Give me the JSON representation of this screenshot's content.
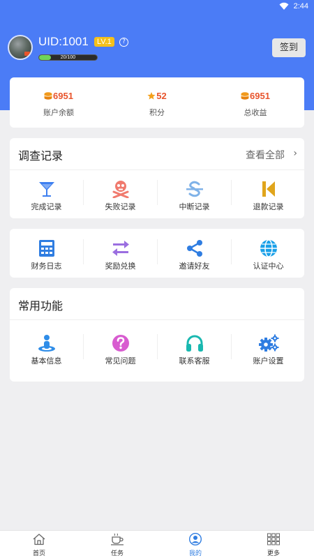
{
  "status_bar": {
    "time": "2:44"
  },
  "profile": {
    "uid": "UID:1001",
    "level": "LV.1",
    "help": "?",
    "xp_text": "20/100",
    "xp_progress": 0.2,
    "signin_label": "签到"
  },
  "stats": [
    {
      "value": "6951",
      "label": "账户余额",
      "icon": "coin-stack-icon"
    },
    {
      "value": "52",
      "label": "积分",
      "icon": "star-icon"
    },
    {
      "value": "6951",
      "label": "总收益",
      "icon": "coin-stack-icon"
    }
  ],
  "survey": {
    "title": "调查记录",
    "view_all": "查看全部",
    "items": [
      {
        "label": "完成记录",
        "icon": "cocktail-glass-icon",
        "color": "#3d7ff0"
      },
      {
        "label": "失败记录",
        "icon": "skull-crossbones-icon",
        "color": "#f07a6e"
      },
      {
        "label": "中断记录",
        "icon": "strikethrough-icon",
        "color": "#7fb2e8"
      },
      {
        "label": "退款记录",
        "icon": "skip-back-icon",
        "color": "#e0a51c"
      }
    ]
  },
  "finance": {
    "items": [
      {
        "label": "财务日志",
        "icon": "calculator-icon",
        "color": "#2f7de1"
      },
      {
        "label": "奖励兑换",
        "icon": "exchange-arrows-icon",
        "color": "#9b6ee0"
      },
      {
        "label": "邀请好友",
        "icon": "share-icon",
        "color": "#2f7de1"
      },
      {
        "label": "认证中心",
        "icon": "globe-icon",
        "color": "#1aa0e8"
      }
    ]
  },
  "common": {
    "title": "常用功能",
    "items": [
      {
        "label": "基本信息",
        "icon": "user-location-icon",
        "color": "#2f8de8"
      },
      {
        "label": "常见问题",
        "icon": "question-circle-icon",
        "color": "#d85cd0"
      },
      {
        "label": "联系客服",
        "icon": "headphones-icon",
        "color": "#19b8b0"
      },
      {
        "label": "账户设置",
        "icon": "gears-icon",
        "color": "#2f7de1"
      }
    ]
  },
  "tabbar": [
    {
      "label": "首页",
      "icon": "house-icon",
      "active": false
    },
    {
      "label": "任务",
      "icon": "coffee-cup-icon",
      "active": false
    },
    {
      "label": "我的",
      "icon": "user-circle-icon",
      "active": true
    },
    {
      "label": "更多",
      "icon": "grid-icon",
      "active": false
    }
  ],
  "colors": {
    "header_blue": "#4b7cf6",
    "accent_orange": "#e8542c",
    "level_yellow": "#f4c01a",
    "active_tab": "#2f7de1"
  }
}
